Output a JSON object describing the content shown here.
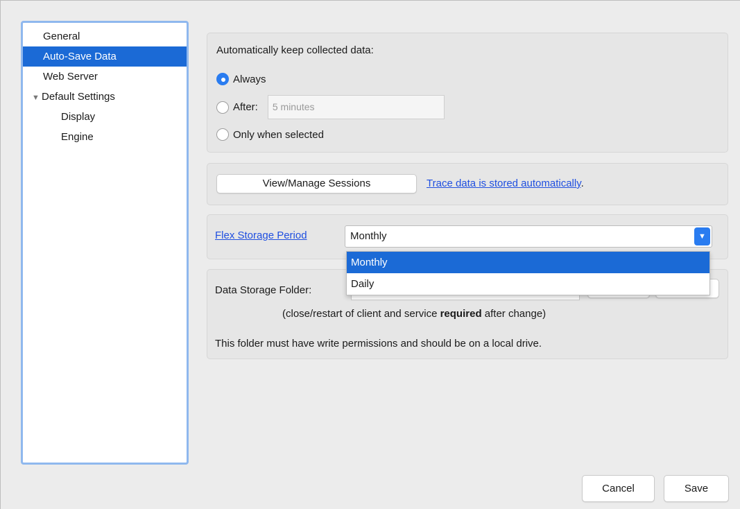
{
  "sidebar": {
    "items": [
      {
        "label": "General"
      },
      {
        "label": "Auto-Save Data"
      },
      {
        "label": "Web Server"
      },
      {
        "label": "Default Settings"
      },
      {
        "label": "Display"
      },
      {
        "label": "Engine"
      }
    ]
  },
  "autosave": {
    "title": "Automatically keep collected data:",
    "options": [
      {
        "label": "Always",
        "selected": true
      },
      {
        "label": "After:",
        "selected": false
      },
      {
        "label": "Only when selected",
        "selected": false
      }
    ],
    "after_value": "5 minutes"
  },
  "sessions": {
    "button_label": "View/Manage Sessions",
    "trace_link": "Trace data is stored automatically",
    "trace_suffix": "."
  },
  "flex": {
    "label": "Flex Storage Period",
    "selected": "Monthly",
    "options": [
      "Monthly",
      "Daily"
    ]
  },
  "storage": {
    "label": "Data Storage Folder:",
    "restart_prefix": "(close/restart of client and service ",
    "restart_bold": "required",
    "restart_suffix": " after change)",
    "permissions_note": "This folder must have write permissions and should be on a local drive."
  },
  "footer": {
    "cancel_label": "Cancel",
    "save_label": "Save"
  },
  "colors": {
    "accent": "#2a7cf0",
    "selection": "#1b6ad6",
    "link": "#1f4fe0"
  }
}
